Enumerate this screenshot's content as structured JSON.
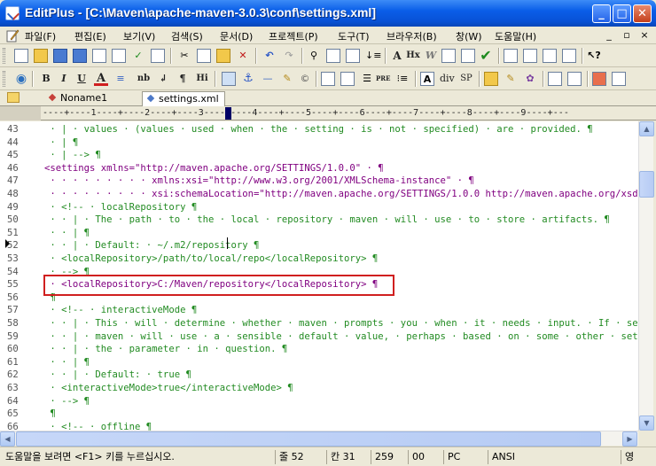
{
  "window": {
    "title": "EditPlus - [C:\\Maven\\apache-maven-3.0.3\\conf\\settings.xml]",
    "minimize_label": "_",
    "maximize_label": "□",
    "close_label": "✕"
  },
  "menu": {
    "items": [
      "파일(F)",
      "편집(E)",
      "보기(V)",
      "검색(S)",
      "문서(D)",
      "프로젝트(P)",
      "도구(T)",
      "브라우저(B)",
      "창(W)",
      "도움말(H)"
    ],
    "mdi": [
      "_",
      "▫",
      "×"
    ]
  },
  "toolbar2_labels": {
    "bold": "B",
    "italic": "I",
    "underline": "U",
    "font": "A",
    "nbsp": "nb",
    "br": "↲",
    "para": "¶",
    "hi": "Hi",
    "pre": "PRE",
    "div": "div",
    "sp": "SP",
    "anchor": "⚓",
    "hx": "Hx"
  },
  "tabs": [
    {
      "label": "Noname1",
      "active": false
    },
    {
      "label": "settings.xml",
      "active": true
    }
  ],
  "ruler": "----+----1----+----2----+----3----+----4----+----5----+----6----+----7----+----8----+----9----+---",
  "editor": {
    "lines": [
      {
        "n": "43",
        "t": " · | · values · (values · used · when · the · setting · is · not · specified) · are · provided. ¶",
        "kind": "comment"
      },
      {
        "n": "44",
        "t": " · | ¶",
        "kind": "comment"
      },
      {
        "n": "45",
        "t": " · | --> ¶",
        "kind": "comment"
      },
      {
        "n": "46",
        "t": "<settings xmlns=\"http://maven.apache.org/SETTINGS/1.0.0\" · ¶",
        "kind": "tag"
      },
      {
        "n": "47",
        "t": " · · · · · · · · · xmlns:xsi=\"http://www.w3.org/2001/XMLSchema-instance\" · ¶",
        "kind": "tag"
      },
      {
        "n": "48",
        "t": " · · · · · · · · · xsi:schemaLocation=\"http://maven.apache.org/SETTINGS/1.0.0 http://maven.apache.org/xsd/s",
        "kind": "tag"
      },
      {
        "n": "49",
        "t": " · <!-- · localRepository ¶",
        "kind": "comment"
      },
      {
        "n": "50",
        "t": " · · | · The · path · to · the · local · repository · maven · will · use · to · store · artifacts. ¶",
        "kind": "comment"
      },
      {
        "n": "51",
        "t": " · · | ¶",
        "kind": "comment"
      },
      {
        "n": "52",
        "t": " · · | · Default: · ~/.m2/repository ¶",
        "kind": "comment"
      },
      {
        "n": "53",
        "t": " · <localRepository>/path/to/local/repo</localRepository> ¶",
        "kind": "comment"
      },
      {
        "n": "54",
        "t": " · --> ¶",
        "kind": "comment"
      },
      {
        "n": "55",
        "t": " · <localRepository>C:/Maven/repository</localRepository> ¶",
        "kind": "tag"
      },
      {
        "n": "56",
        "t": " ¶",
        "kind": "comment"
      },
      {
        "n": "57",
        "t": " · <!-- · interactiveMode ¶",
        "kind": "comment"
      },
      {
        "n": "58",
        "t": " · · | · This · will · determine · whether · maven · prompts · you · when · it · needs · input. · If · set · to · false, ¶",
        "kind": "comment"
      },
      {
        "n": "59",
        "t": " · · | · maven · will · use · a · sensible · default · value, · perhaps · based · on · some · other · setting, · for ¶",
        "kind": "comment"
      },
      {
        "n": "60",
        "t": " · · | · the · parameter · in · question. ¶",
        "kind": "comment"
      },
      {
        "n": "61",
        "t": " · · | ¶",
        "kind": "comment"
      },
      {
        "n": "62",
        "t": " · · | · Default: · true ¶",
        "kind": "comment"
      },
      {
        "n": "63",
        "t": " · <interactiveMode>true</interactiveMode> ¶",
        "kind": "comment"
      },
      {
        "n": "64",
        "t": " · --> ¶",
        "kind": "comment"
      },
      {
        "n": "65",
        "t": " ¶",
        "kind": "comment"
      },
      {
        "n": "66",
        "t": " · <!-- · offline ¶",
        "kind": "comment"
      }
    ]
  },
  "status": {
    "help": "도움말을 보려면 <F1> 키를 누르십시오.",
    "line": "줄 52",
    "col": "칸 31",
    "total": "259",
    "sel": "00",
    "format": "PC",
    "encoding": "ANSI",
    "mode": "영"
  }
}
